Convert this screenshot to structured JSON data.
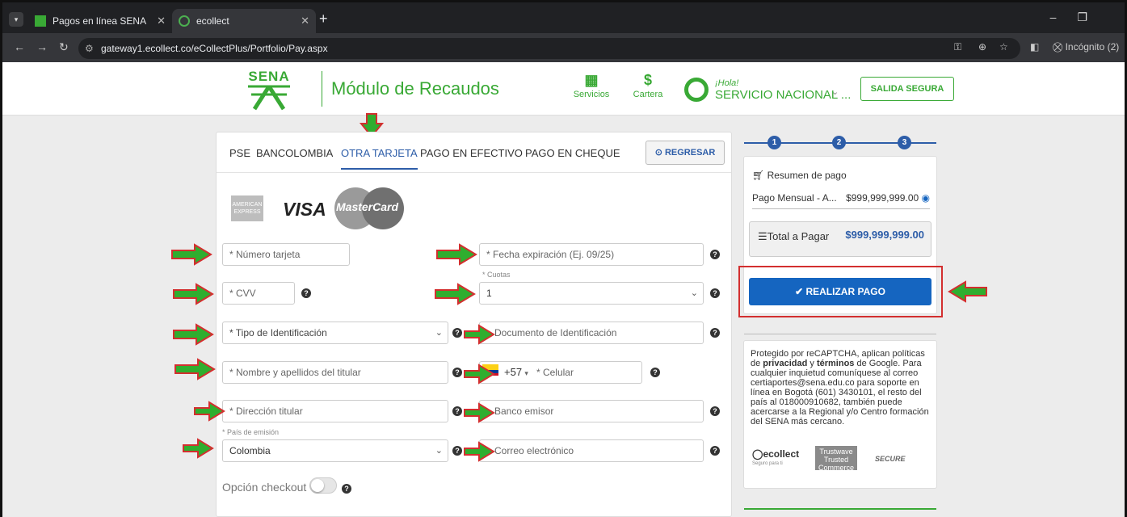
{
  "browser": {
    "tabs": [
      {
        "title": "Pagos en línea SENA"
      },
      {
        "title": "ecollect"
      }
    ],
    "url": "gateway1.ecollect.co/eCollectPlus/Portfolio/Pay.aspx",
    "incognito": "Incógnito (2)"
  },
  "header": {
    "logo_text": "SENA",
    "title": "Módulo de Recaudos",
    "servicios": "Servicios",
    "cartera": "Cartera",
    "hola": "¡Hola!",
    "user": "SERVICIO NACIONAL ...",
    "salida": "SALIDA SEGURA"
  },
  "payment_tabs": {
    "items": [
      "PSE",
      "BANCOLOMBIA",
      "OTRA TARJETA",
      "PAGO EN EFECTIVO",
      "PAGO EN CHEQUE"
    ],
    "active": "OTRA TARJETA",
    "regresar": "REGRESAR"
  },
  "card_logos": {
    "amex": "AMERICAN EXPRESS",
    "visa": "VISA",
    "mastercard": "MasterCard"
  },
  "form": {
    "numero_tarjeta": "* Número tarjeta",
    "fecha_expiracion": "* Fecha expiración (Ej. 09/25)",
    "cuotas_label": "* Cuotas",
    "cuotas_value": "1",
    "cvv": "* CVV",
    "tipo_identificacion": "* Tipo de Identificación",
    "documento_identificacion": "Documento de Identificación",
    "nombre_titular": "* Nombre y apellidos del titular",
    "phone_code": "+57",
    "celular": "* Celular",
    "direccion_titular": "* Dirección titular",
    "banco_emisor": "Banco emisor",
    "pais_label": "* País de emisión",
    "pais_value": "Colombia",
    "correo": "Correo electrónico",
    "checkout_label": "Opción checkout",
    "checkout_enabled": false
  },
  "steps": [
    "1",
    "2",
    "3"
  ],
  "summary": {
    "title": "Resumen de pago",
    "item_name": "Pago Mensual - A...",
    "item_amount": "$999,999,999.00",
    "total_label": "Total a Pagar",
    "total_value": "$999,999,999.00",
    "pay_button": "REALIZAR PAGO"
  },
  "info": {
    "text1": "Protegido por reCAPTCHA, aplican políticas de ",
    "privacidad": "privacidad",
    "text2": " y ",
    "terminos": "términos",
    "text3": " de Google. Para cualquier inquietud comuníquese al correo certiaportes@sena.edu.co para soporte en línea en Bogotá (601) 3430101, el resto del país al 018000910682, también puede acercarse a la Regional y/o Centro formación del SENA más cercano.",
    "badge_ecollect": "ecollect",
    "badge_ecollect_sub": "Seguro para ti",
    "badge_trustwave": "Trustwave Trusted Commerce",
    "badge_secure": "SECURE"
  },
  "colors": {
    "sena_green": "#39a935",
    "primary_blue": "#1565c0",
    "arrow_green": "#2fae2f",
    "arrow_border": "#d32f2f"
  }
}
